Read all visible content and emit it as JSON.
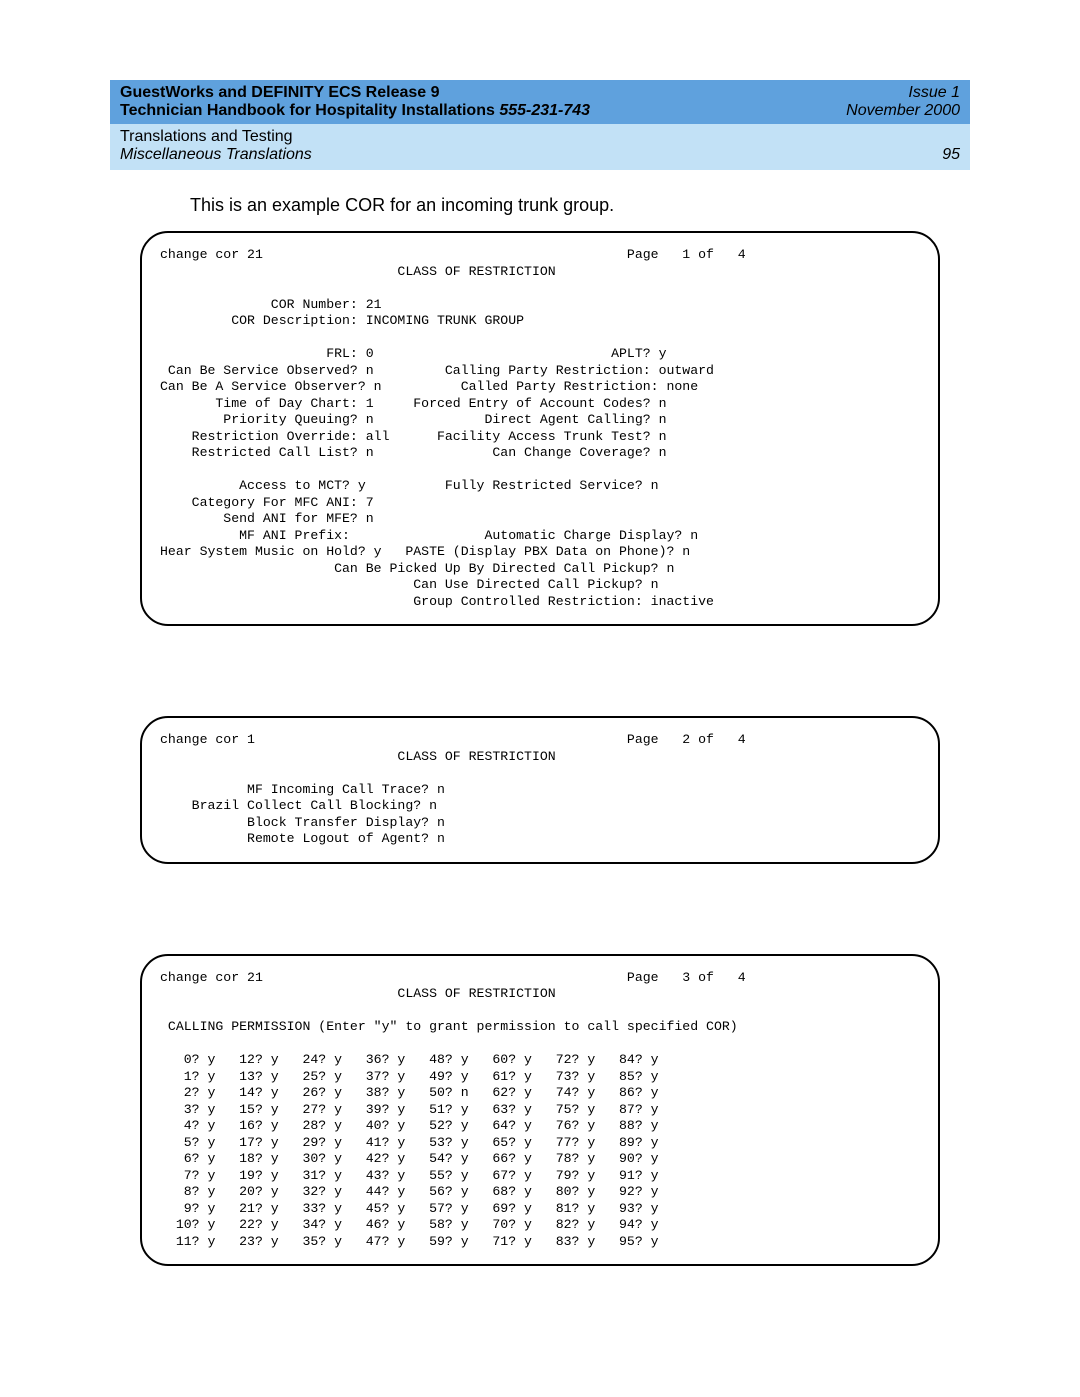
{
  "header": {
    "title_line1": "GuestWorks and DEFINITY ECS Release 9",
    "title_line2_a": "Technician Handbook for Hospitality Installations  ",
    "title_line2_b": "555-231-743",
    "issue": "Issue 1",
    "date": "November 2000",
    "chapter": "Translations and Testing",
    "section": "Miscellaneous Translations",
    "pagenum": "95"
  },
  "intro": "This is an example COR for an incoming trunk group.",
  "screen1": "change cor 21                                              Page   1 of   4\n                              CLASS OF RESTRICTION\n\n              COR Number: 21\n         COR Description: INCOMING TRUNK GROUP\n\n                     FRL: 0                              APLT? y\n Can Be Service Observed? n         Calling Party Restriction: outward\nCan Be A Service Observer? n          Called Party Restriction: none\n       Time of Day Chart: 1     Forced Entry of Account Codes? n\n        Priority Queuing? n              Direct Agent Calling? n\n    Restriction Override: all      Facility Access Trunk Test? n\n    Restricted Call List? n               Can Change Coverage? n\n\n          Access to MCT? y          Fully Restricted Service? n\n    Category For MFC ANI: 7\n        Send ANI for MFE? n\n          MF ANI Prefix:                 Automatic Charge Display? n\nHear System Music on Hold? y   PASTE (Display PBX Data on Phone)? n\n                      Can Be Picked Up By Directed Call Pickup? n\n                                Can Use Directed Call Pickup? n\n                                Group Controlled Restriction: inactive",
  "screen2": "change cor 1                                               Page   2 of   4\n                              CLASS OF RESTRICTION\n\n           MF Incoming Call Trace? n\n    Brazil Collect Call Blocking? n\n           Block Transfer Display? n\n           Remote Logout of Agent? n",
  "screen3_header": "change cor 21                                              Page   3 of   4\n                              CLASS OF RESTRICTION\n\n CALLING PERMISSION (Enter \"y\" to grant permission to call specified COR)\n",
  "screen3_rows": [
    [
      0,
      12,
      24,
      36,
      48,
      60,
      72,
      84
    ],
    [
      1,
      13,
      25,
      37,
      49,
      61,
      73,
      85
    ],
    [
      2,
      14,
      26,
      38,
      50,
      62,
      74,
      86
    ],
    [
      3,
      15,
      27,
      39,
      51,
      63,
      75,
      87
    ],
    [
      4,
      16,
      28,
      40,
      52,
      64,
      76,
      88
    ],
    [
      5,
      17,
      29,
      41,
      53,
      65,
      77,
      89
    ],
    [
      6,
      18,
      30,
      42,
      54,
      66,
      78,
      90
    ],
    [
      7,
      19,
      31,
      43,
      55,
      67,
      79,
      91
    ],
    [
      8,
      20,
      32,
      44,
      56,
      68,
      80,
      92
    ],
    [
      9,
      21,
      33,
      45,
      57,
      69,
      81,
      93
    ],
    [
      10,
      22,
      34,
      46,
      58,
      70,
      82,
      94
    ],
    [
      11,
      23,
      35,
      47,
      59,
      71,
      83,
      95
    ]
  ],
  "screen3_n": 50
}
